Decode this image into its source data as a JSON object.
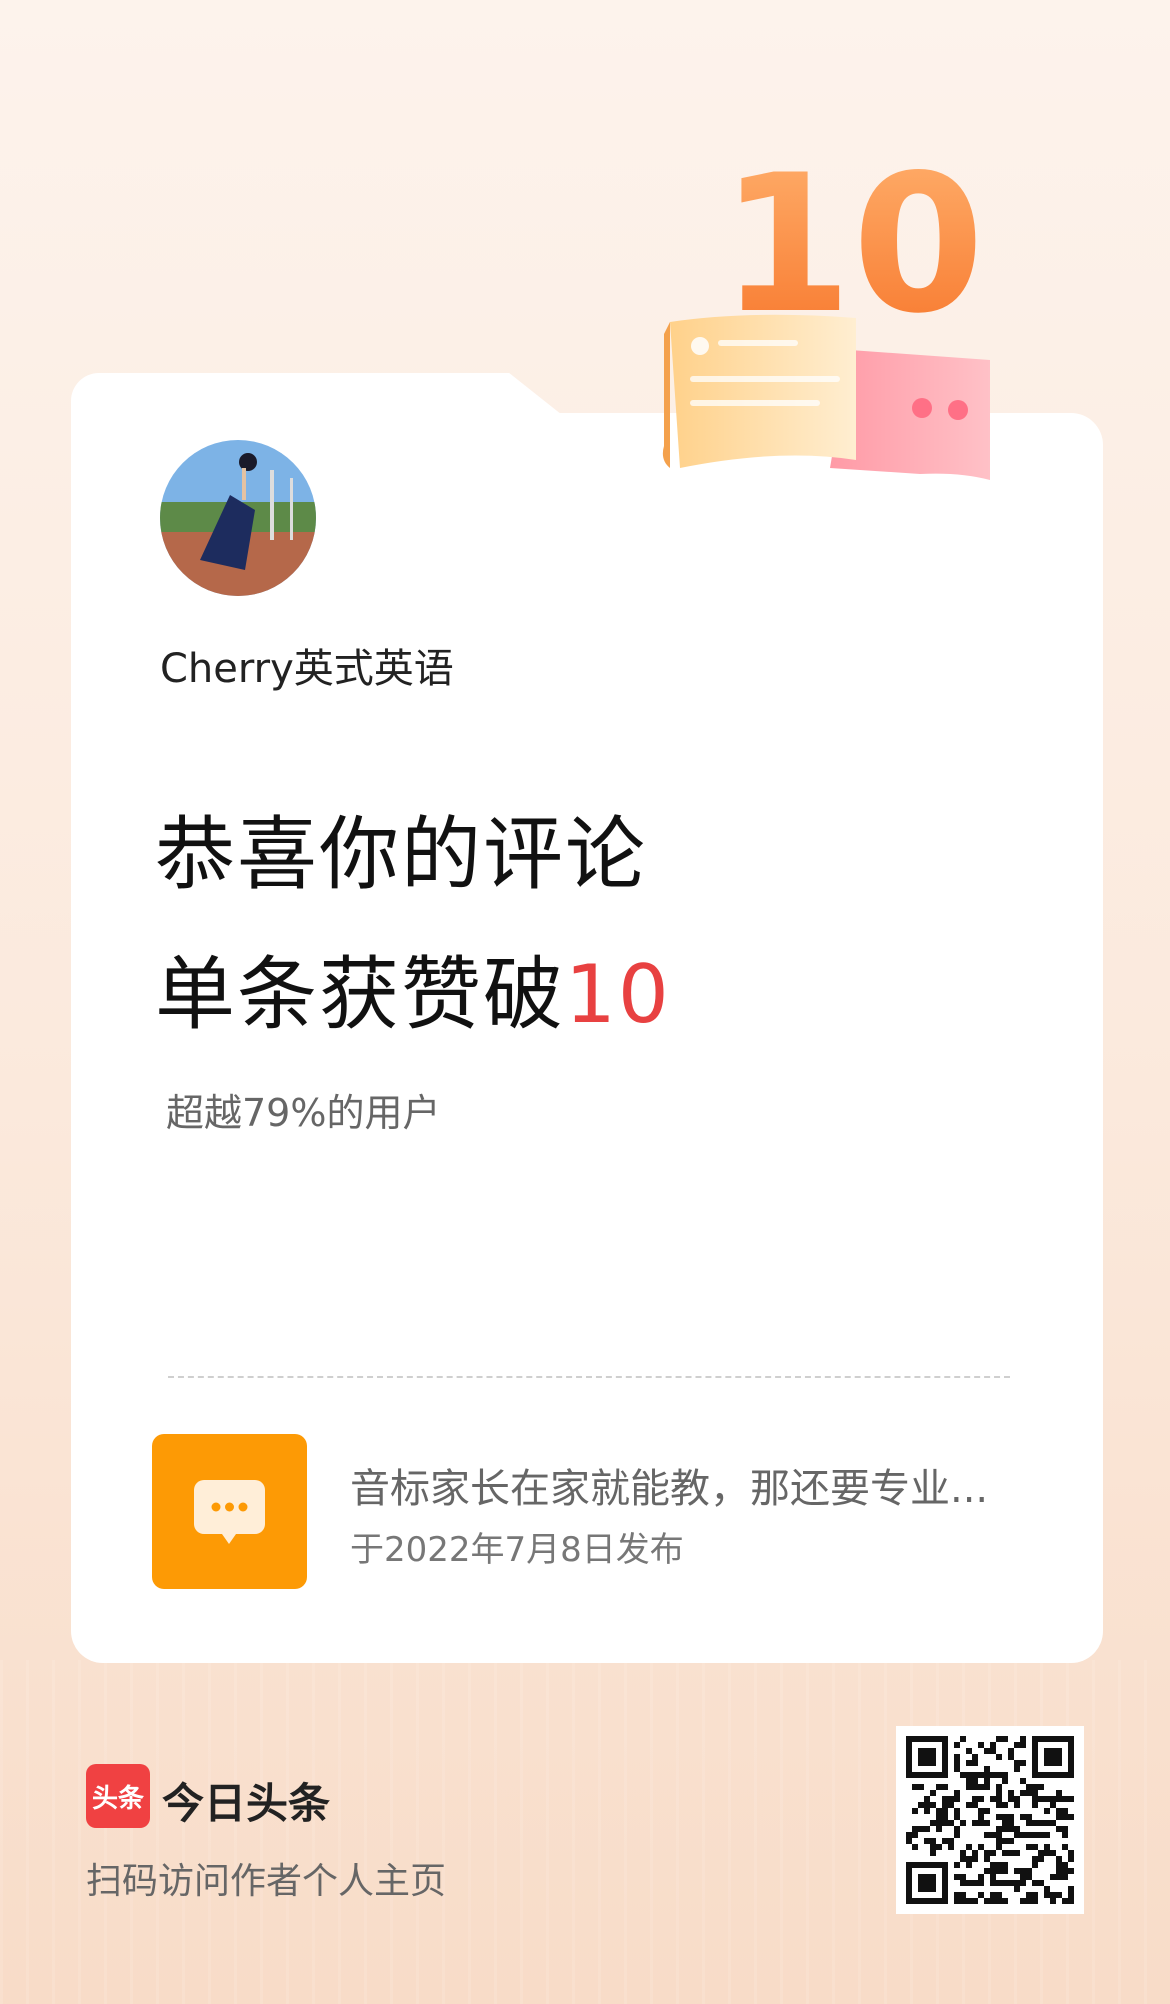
{
  "badge": {
    "number": "10"
  },
  "user": {
    "name": "Cherry英式英语"
  },
  "headline": {
    "line1": "恭喜你的评论",
    "line2_prefix": "单条获赞破",
    "line2_number": "10"
  },
  "subtitle": "超越79%的用户",
  "post": {
    "icon": "comment-icon",
    "title": "音标家长在家就能教，那还要专业...",
    "date": "于2022年7月8日发布"
  },
  "footer": {
    "logo_text": "头条",
    "app_name": "今日头条",
    "hint": "扫码访问作者个人主页"
  },
  "colors": {
    "accent_red": "#e84141",
    "icon_orange": "#fd9a05",
    "badge_orange": "#f9893d"
  }
}
